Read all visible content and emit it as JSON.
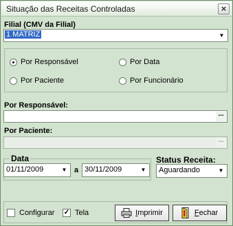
{
  "window": {
    "title": "Situação das Receitas Controladas",
    "close_glyph": "×"
  },
  "filial": {
    "label": "Filial (CMV da Filial)",
    "value": "1 MATRIZ"
  },
  "options": [
    {
      "label": "Por Responsável",
      "selected": true
    },
    {
      "label": "Por Data",
      "selected": false
    },
    {
      "label": "Por Paciente",
      "selected": false
    },
    {
      "label": "Por Funcionário",
      "selected": false
    }
  ],
  "responsavel": {
    "label": "Por Responsável:",
    "value": "",
    "button": "..."
  },
  "paciente": {
    "label": "Por Paciente:",
    "value": "",
    "button": "..."
  },
  "data": {
    "label": "Data",
    "from": "01/11/2009",
    "separator": "a",
    "to": "30/11/2009"
  },
  "status": {
    "label": "Status Receita:",
    "value": "Aguardando"
  },
  "footer": {
    "configurar": {
      "label": "Configurar",
      "checked": false
    },
    "tela": {
      "label": "Tela",
      "checked": true
    },
    "imprimir": {
      "label_underline": "I",
      "label_rest": "mprimir"
    },
    "fechar": {
      "label_underline": "F",
      "label_rest": "echar"
    }
  }
}
